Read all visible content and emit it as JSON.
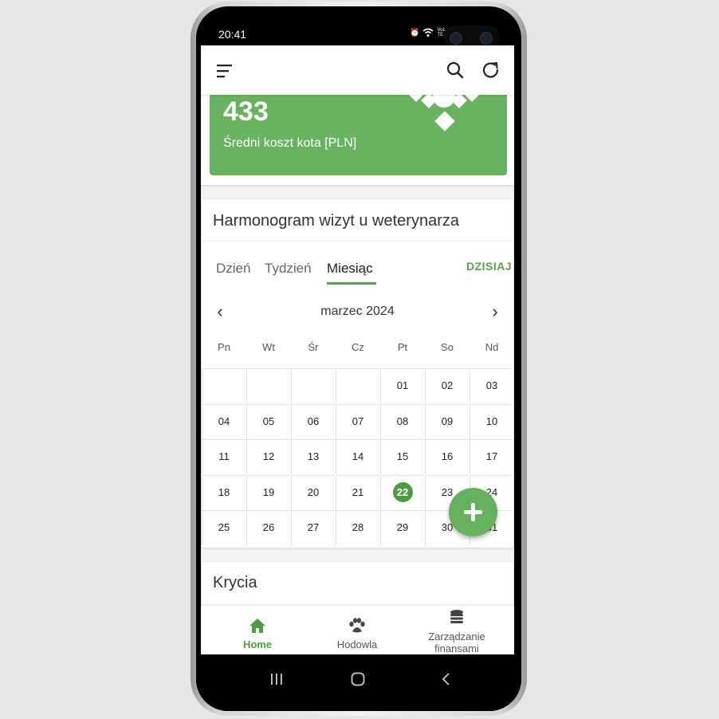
{
  "status_bar": {
    "time": "20:41",
    "network": "VoLTE"
  },
  "appbar": {
    "menu_icon": "menu-icon",
    "search_icon": "search-icon",
    "refresh_icon": "refresh-icon"
  },
  "stat_card": {
    "value": "433",
    "label": "Średni koszt kota [PLN]",
    "color": "#68b360"
  },
  "calendar": {
    "title": "Harmonogram wizyt u weterynarza",
    "tabs": [
      {
        "label": "Dzień",
        "active": false
      },
      {
        "label": "Tydzień",
        "active": false
      },
      {
        "label": "Miesiąc",
        "active": true
      }
    ],
    "today_button": "DZISIAJ",
    "month": "marzec 2024",
    "weekdays": [
      "Pn",
      "Wt",
      "Śr",
      "Cz",
      "Pt",
      "So",
      "Nd"
    ],
    "weeks": [
      [
        "",
        "",
        "",
        "",
        "01",
        "02",
        "03"
      ],
      [
        "04",
        "05",
        "06",
        "07",
        "08",
        "09",
        "10"
      ],
      [
        "11",
        "12",
        "13",
        "14",
        "15",
        "16",
        "17"
      ],
      [
        "18",
        "19",
        "20",
        "21",
        "22",
        "23",
        "24"
      ],
      [
        "25",
        "26",
        "27",
        "28",
        "29",
        "30",
        "31"
      ]
    ],
    "today": "22",
    "accent": "#4e9b44"
  },
  "section_krycia": {
    "title": "Krycia"
  },
  "bottom_nav": [
    {
      "label": "Home",
      "icon": "home-icon",
      "active": true
    },
    {
      "label": "Hodowla",
      "icon": "paw-icon",
      "active": false
    },
    {
      "label": "Zarządzanie finansami",
      "icon": "coins-icon",
      "active": false
    }
  ],
  "fab": {
    "icon": "plus-icon"
  }
}
